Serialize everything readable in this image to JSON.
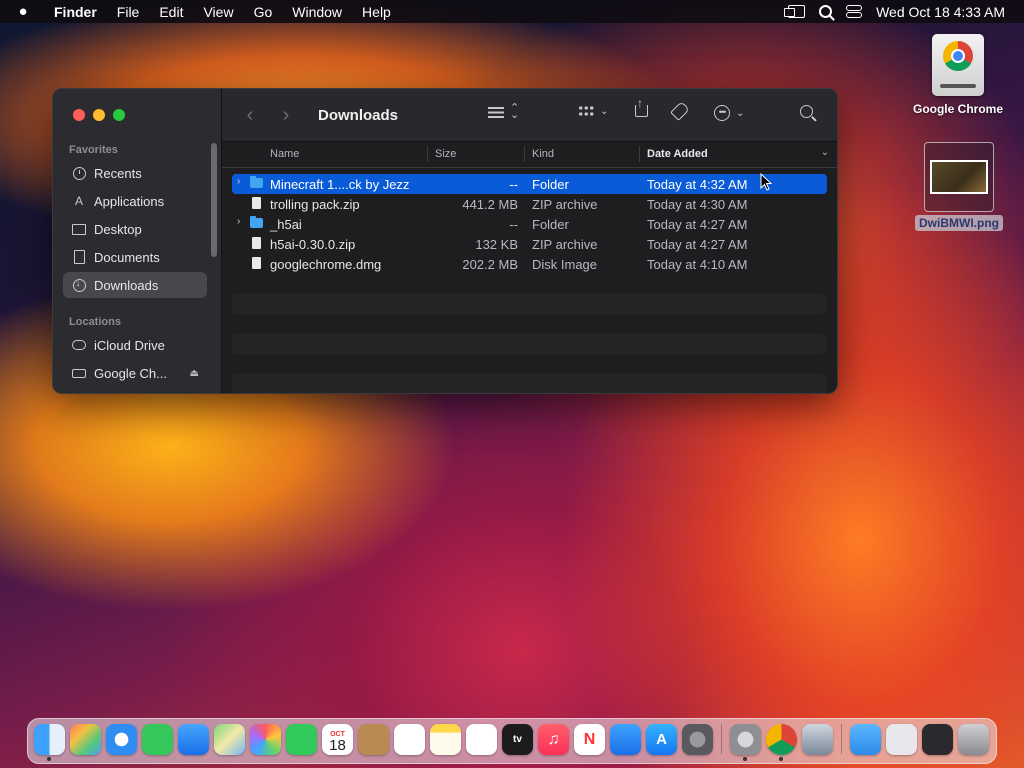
{
  "menubar": {
    "app_name": "Finder",
    "items": [
      "File",
      "Edit",
      "View",
      "Go",
      "Window",
      "Help"
    ],
    "clock": "Wed Oct 18  4:33 AM"
  },
  "desktop": {
    "chrome_disk_label": "Google Chrome",
    "png_file_label": "DwiBMWI.png"
  },
  "finder": {
    "title": "Downloads",
    "sidebar": {
      "favorites_heading": "Favorites",
      "favorites": [
        {
          "label": "Recents",
          "icon": "clock-icon"
        },
        {
          "label": "Applications",
          "icon": "applications-icon"
        },
        {
          "label": "Desktop",
          "icon": "desktop-icon"
        },
        {
          "label": "Documents",
          "icon": "document-icon"
        },
        {
          "label": "Downloads",
          "icon": "downloads-icon"
        }
      ],
      "locations_heading": "Locations",
      "locations": [
        {
          "label": "iCloud Drive",
          "icon": "cloud-icon"
        },
        {
          "label": "Google Ch...",
          "icon": "drive-icon"
        }
      ]
    },
    "columns": {
      "name": "Name",
      "size": "Size",
      "kind": "Kind",
      "date": "Date Added"
    },
    "rows": [
      {
        "name": "Minecraft 1....ck by Jezz",
        "size": "--",
        "kind": "Folder",
        "date": "Today at 4:32 AM",
        "type": "folder"
      },
      {
        "name": "trolling pack.zip",
        "size": "441.2 MB",
        "kind": "ZIP archive",
        "date": "Today at 4:30 AM",
        "type": "file"
      },
      {
        "name": "_h5ai",
        "size": "--",
        "kind": "Folder",
        "date": "Today at 4:27 AM",
        "type": "folder"
      },
      {
        "name": "h5ai-0.30.0.zip",
        "size": "132 KB",
        "kind": "ZIP archive",
        "date": "Today at 4:27 AM",
        "type": "file"
      },
      {
        "name": "googlechrome.dmg",
        "size": "202.2 MB",
        "kind": "Disk Image",
        "date": "Today at 4:10 AM",
        "type": "file"
      }
    ],
    "selected_row": 0
  },
  "dock": {
    "calendar_month": "OCT",
    "calendar_day": "18",
    "tv_label": "tv"
  },
  "colors": {
    "selection": "#0a5bd8",
    "folder": "#43a4f0"
  }
}
